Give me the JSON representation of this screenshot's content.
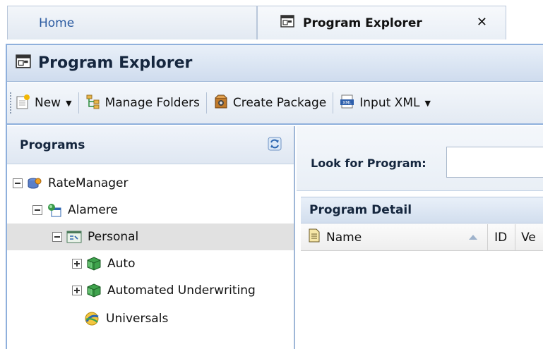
{
  "tabs": {
    "home_label": "Home",
    "program_explorer_label": "Program Explorer",
    "close_glyph": "✕"
  },
  "window": {
    "title": "Program Explorer"
  },
  "toolbar": {
    "new_label": "New",
    "manage_folders_label": "Manage Folders",
    "create_package_label": "Create Package",
    "input_xml_label": "Input XML",
    "caret": "▼"
  },
  "left_panel": {
    "title": "Programs",
    "tree": [
      {
        "label": "RateManager",
        "toggle": "minus",
        "icon": "database-icon"
      },
      {
        "label": "Alamere",
        "toggle": "minus",
        "icon": "organization-icon"
      },
      {
        "label": "Personal",
        "toggle": "minus",
        "icon": "line-of-business-icon",
        "selected": true
      },
      {
        "label": "Auto",
        "toggle": "plus",
        "icon": "cube-icon"
      },
      {
        "label": "Automated Underwriting",
        "toggle": "plus",
        "icon": "cube-icon"
      },
      {
        "label": "Universals",
        "toggle": "none",
        "icon": "globe-icon"
      }
    ]
  },
  "right_panel": {
    "search_label": "Look for Program:",
    "search_value": "",
    "detail_title": "Program Detail",
    "columns": {
      "name": "Name",
      "id": "ID",
      "version": "Ve"
    }
  },
  "colors": {
    "frame_border": "#8fb0dc",
    "header_gradient_top": "#e9f0f9",
    "header_gradient_bottom": "#cfdcee",
    "selected_row": "#e1e1e1",
    "tab_link": "#2a5aa0"
  }
}
